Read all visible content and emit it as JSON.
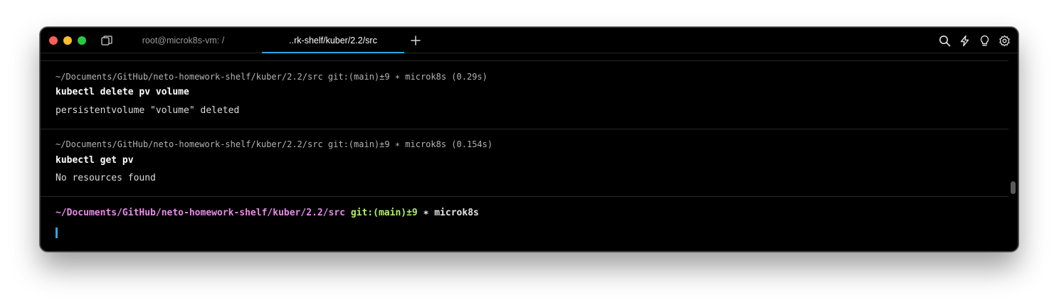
{
  "window": {
    "tabs": [
      {
        "label": "root@microk8s-vm: /",
        "active": false
      },
      {
        "label": "..rk-shelf/kuber/2.2/src",
        "active": true
      }
    ],
    "new_tab_symbol": "+",
    "toolbar_icons": [
      "search-icon",
      "bolt-icon",
      "lightbulb-icon",
      "gear-icon"
    ]
  },
  "blocks": [
    {
      "prompt": "~/Documents/GitHub/neto-homework-shelf/kuber/2.2/src git:(main)±9 ∗ microk8s (0.29s)",
      "command": "kubectl delete pv volume",
      "output": "persistentvolume \"volume\" deleted"
    },
    {
      "prompt": "~/Documents/GitHub/neto-homework-shelf/kuber/2.2/src git:(main)±9 ∗ microk8s (0.154s)",
      "command": "kubectl get pv",
      "output": "No resources found"
    }
  ],
  "live_prompt": {
    "path": "~/Documents/GitHub/neto-homework-shelf/kuber/2.2/src",
    "git": "git:(main)±9",
    "rest": "∗ microk8s"
  },
  "colors": {
    "background": "#000000",
    "accent": "#2ba9e0",
    "prompt_path": "#e68be8",
    "prompt_git": "#b4ef6a"
  }
}
